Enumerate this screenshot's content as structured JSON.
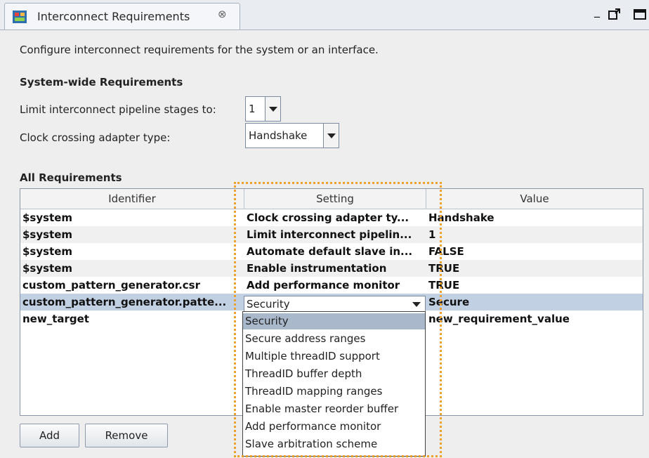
{
  "tab": {
    "title": "Interconnect Requirements",
    "close_glyph": "⊗"
  },
  "window_controls": {
    "minimize": "_",
    "detach": "□↗",
    "maximize": "□"
  },
  "description": "Configure interconnect requirements for the system or an interface.",
  "system_wide": {
    "heading": "System-wide Requirements",
    "pipeline_label": "Limit interconnect pipeline stages to:",
    "pipeline_value": "1",
    "clock_label": "Clock crossing adapter type:",
    "clock_value": "Handshake"
  },
  "all_requirements": {
    "heading": "All Requirements",
    "columns": [
      "Identifier",
      "Setting",
      "Value"
    ],
    "rows": [
      {
        "identifier": "$system",
        "setting": "Clock crossing adapter ty...",
        "value": "Handshake"
      },
      {
        "identifier": "$system",
        "setting": "Limit interconnect pipelin...",
        "value": "1"
      },
      {
        "identifier": "$system",
        "setting": "Automate default slave in...",
        "value": "FALSE"
      },
      {
        "identifier": "$system",
        "setting": "Enable instrumentation",
        "value": "TRUE"
      },
      {
        "identifier": "custom_pattern_generator.csr",
        "setting": "Add performance monitor",
        "value": "TRUE"
      },
      {
        "identifier": "custom_pattern_generator.patte...",
        "setting": "Security",
        "value": "Secure"
      },
      {
        "identifier": "new_target",
        "setting": "",
        "value": "new_requirement_value"
      }
    ]
  },
  "dropdown": {
    "current": "Security",
    "options": [
      "Security",
      "Secure address ranges",
      "Multiple threadID support",
      "ThreadID buffer depth",
      "ThreadID mapping ranges",
      "Enable master reorder buffer",
      "Add performance monitor",
      "Slave arbitration scheme"
    ]
  },
  "buttons": {
    "add": "Add",
    "remove": "Remove"
  },
  "colors": {
    "selected_row": "#c1d0e2",
    "selected_option": "#aab8cb",
    "highlight_border": "#f0a030"
  }
}
